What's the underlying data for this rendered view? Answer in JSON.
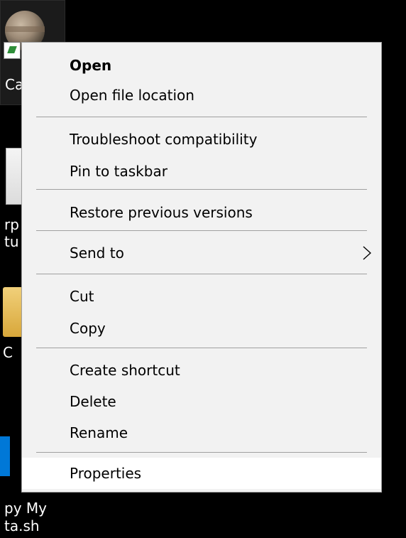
{
  "desktop": {
    "labels": {
      "top": "Ca",
      "doc_line1": "rp",
      "doc_line2": "tu",
      "folder": "C",
      "bottom_line1": "py My",
      "bottom_line2": "ta.sh"
    }
  },
  "context_menu": {
    "items": [
      {
        "label": "Open"
      },
      {
        "label": "Open file location"
      },
      {
        "label": "Troubleshoot compatibility"
      },
      {
        "label": "Pin to taskbar"
      },
      {
        "label": "Restore previous versions"
      },
      {
        "label": "Send to"
      },
      {
        "label": "Cut"
      },
      {
        "label": "Copy"
      },
      {
        "label": "Create shortcut"
      },
      {
        "label": "Delete"
      },
      {
        "label": "Rename"
      },
      {
        "label": "Properties"
      }
    ],
    "submenu_icon": "chevron-right-icon"
  },
  "colors": {
    "menu_background": "#f2f2f2",
    "menu_hover": "#ffffff",
    "separator": "#a0a0a0",
    "desktop_background": "#000000",
    "selection_blue": "#0078d7"
  }
}
